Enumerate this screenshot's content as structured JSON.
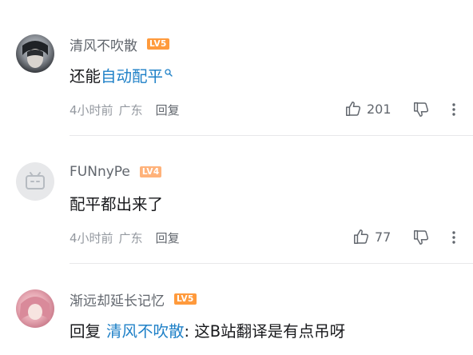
{
  "comments": [
    {
      "username": "清风不吹散",
      "level": "LV5",
      "level_color": "#ff9a3c",
      "text_plain": "还能",
      "text_link": "自动配平",
      "time": "4小时前",
      "location": "广东",
      "reply_label": "回复",
      "likes": "201"
    },
    {
      "username": "FUNnyPe",
      "level": "LV4",
      "level_color": "#ffb27a",
      "text_plain": "配平都出来了",
      "time": "4小时前",
      "location": "广东",
      "reply_label": "回复",
      "likes": "77"
    },
    {
      "username": "渐远却延长记忆",
      "level": "LV5",
      "level_color": "#ff9a3c",
      "reply_prefix": "回复",
      "reply_to": "清风不吹散",
      "text_plain": ": 这B站翻译是有点吊呀"
    }
  ],
  "icons": {
    "search": "search-icon",
    "like": "thumbs-up-icon",
    "dislike": "thumbs-down-icon",
    "more": "more-vertical-icon"
  }
}
